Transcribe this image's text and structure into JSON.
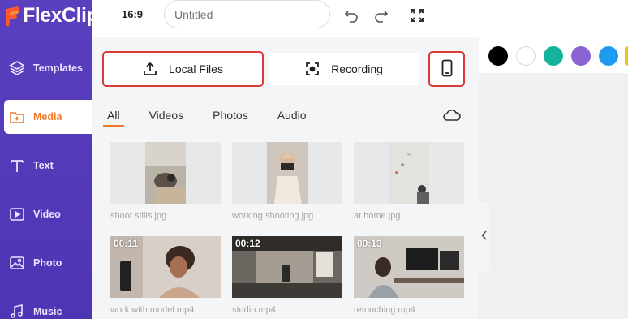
{
  "app": {
    "logo_text": "FlexClip"
  },
  "sidebar": {
    "items": [
      {
        "label": "Templates",
        "icon": "layers-icon"
      },
      {
        "label": "Media",
        "icon": "media-folder-icon",
        "active": true
      },
      {
        "label": "Text",
        "icon": "text-t-icon"
      },
      {
        "label": "Video",
        "icon": "video-play-icon"
      },
      {
        "label": "Photo",
        "icon": "photo-icon"
      },
      {
        "label": "Music",
        "icon": "music-note-icon"
      }
    ]
  },
  "topbar": {
    "ratio": "16:9",
    "title_placeholder": "Untitled"
  },
  "media": {
    "local_files_label": "Local Files",
    "recording_label": "Recording",
    "tabs": [
      "All",
      "Videos",
      "Photos",
      "Audio"
    ],
    "active_tab": "All",
    "items": [
      {
        "name": "shoot stills.jpg",
        "duration": ""
      },
      {
        "name": "working shooting.jpg",
        "duration": ""
      },
      {
        "name": "at home.jpg",
        "duration": ""
      },
      {
        "name": "work with model.mp4",
        "duration": "00:11"
      },
      {
        "name": "studio.mp4",
        "duration": "00:12"
      },
      {
        "name": "retouching.mp4",
        "duration": "00:13"
      }
    ]
  },
  "colors": {
    "accent": "#f07a2a",
    "sidebar": "#5a3fbf",
    "highlight": "#d93a3a",
    "swatches": [
      "#000000",
      "#ffffff",
      "#12b39a",
      "#8a63d2",
      "#1e9bf0",
      "#f2c011"
    ]
  }
}
